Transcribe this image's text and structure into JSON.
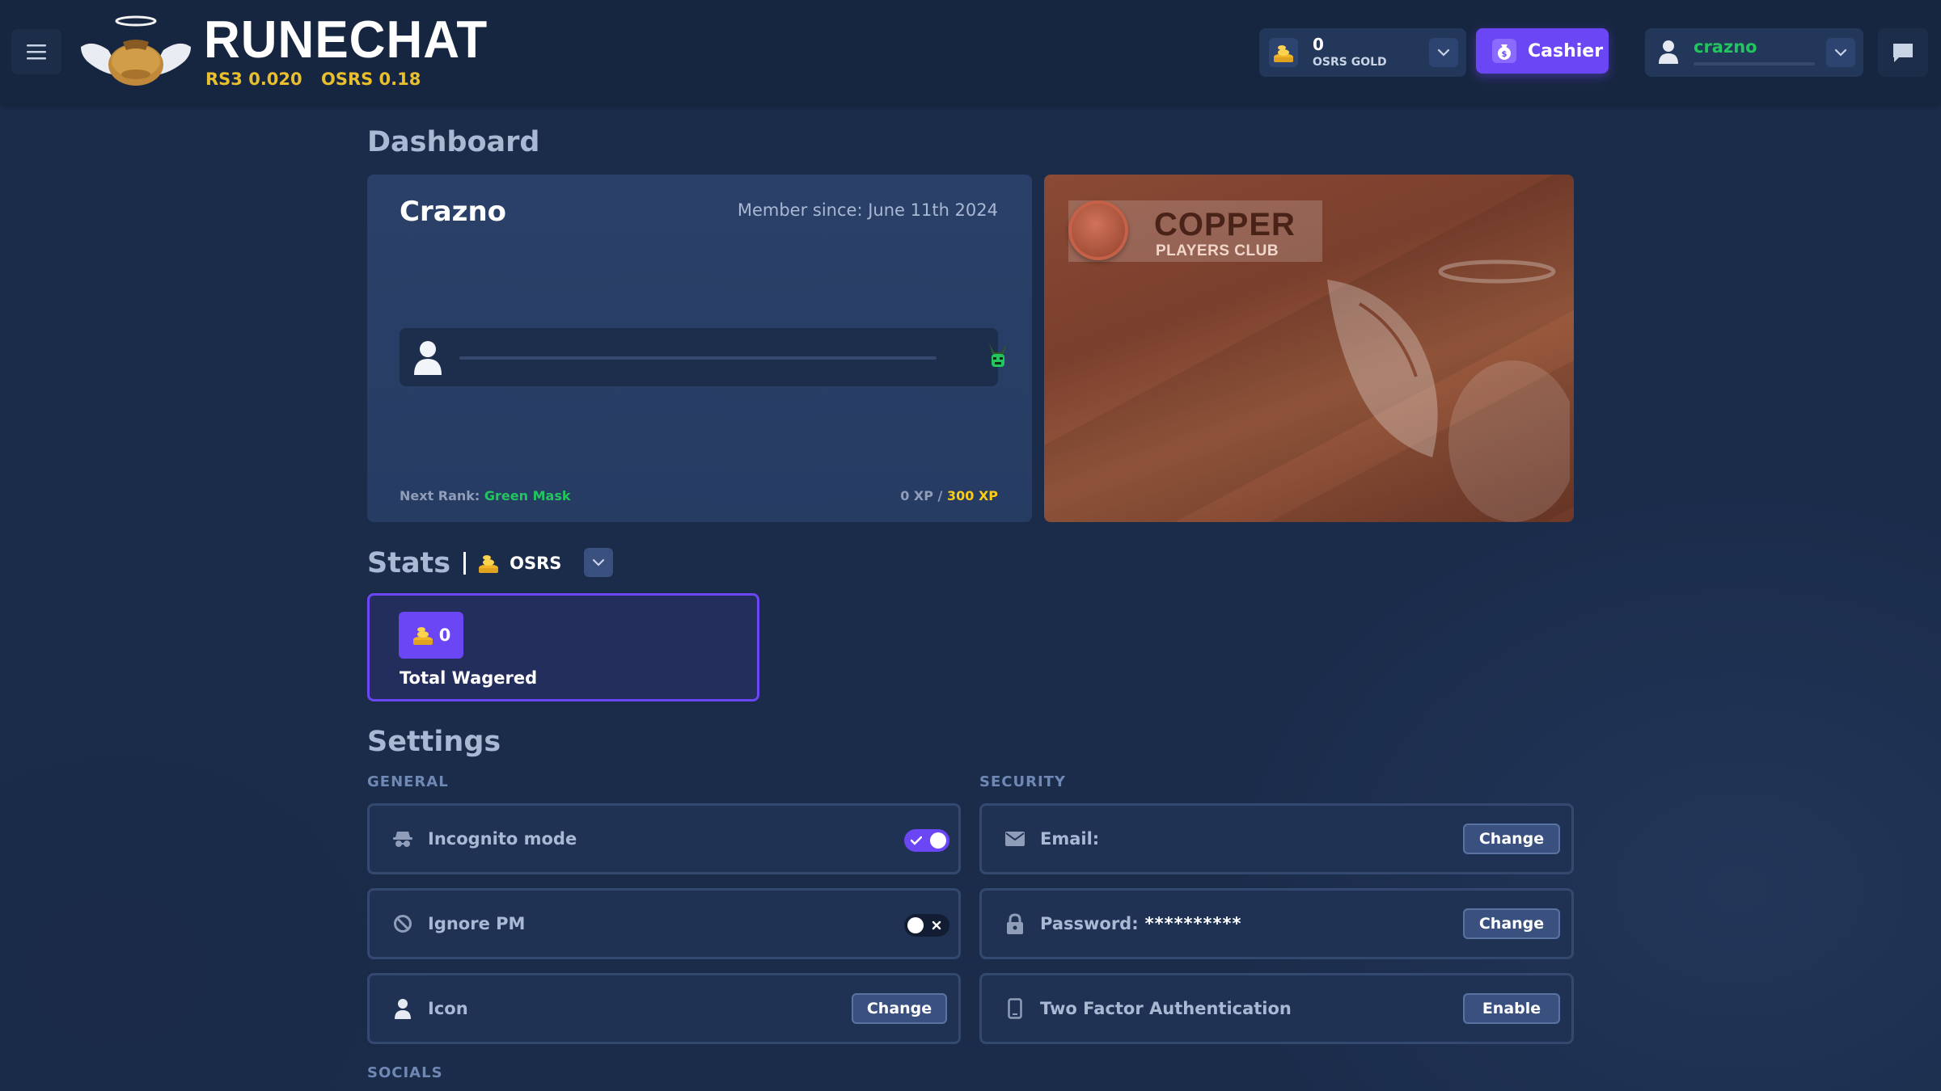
{
  "app": {
    "brand": "RUNECHAT",
    "prices": [
      "RS3 0.020",
      "OSRS 0.18"
    ]
  },
  "header": {
    "balance_amount": "0",
    "balance_currency": "OSRS GOLD",
    "cashier_label": "Cashier",
    "username": "crazno",
    "icons": [
      "menu-icon",
      "coin-icon",
      "chevron-down-icon",
      "money-bag-icon",
      "user-icon",
      "chat-icon"
    ]
  },
  "dashboard": {
    "title": "Dashboard",
    "profile_name": "Crazno",
    "member_since": "Member since: June 11th 2024",
    "next_rank_label": "Next Rank:",
    "next_rank_value": "Green Mask",
    "xp_current": "0 XP",
    "xp_separator": "/",
    "xp_max": "300 XP",
    "xp_progress": 0,
    "club_title": "COPPER",
    "club_subtitle": "PLAYERS CLUB"
  },
  "stats": {
    "title": "Stats",
    "currency": "OSRS",
    "total_wagered_value": "0",
    "total_wagered_label": "Total Wagered"
  },
  "settings": {
    "title": "Settings",
    "general_label": "GENERAL",
    "security_label": "SECURITY",
    "socials_label": "SOCIALS",
    "general": [
      {
        "label": "Incognito mode",
        "control": "toggle",
        "state": "on"
      },
      {
        "label": "Ignore PM",
        "control": "toggle",
        "state": "off"
      },
      {
        "label": "Icon",
        "control": "button",
        "button": "Change"
      }
    ],
    "security": [
      {
        "label": "Email:",
        "value": "",
        "button": "Change"
      },
      {
        "label": "Password:",
        "value": "**********",
        "button": "Change"
      },
      {
        "label": "Two Factor Authentication",
        "value": "",
        "button": "Enable"
      }
    ]
  },
  "colors": {
    "accent": "#6b46f5",
    "gold": "#e8bf2e",
    "green": "#22c55e",
    "xp_max": "#facc15"
  }
}
